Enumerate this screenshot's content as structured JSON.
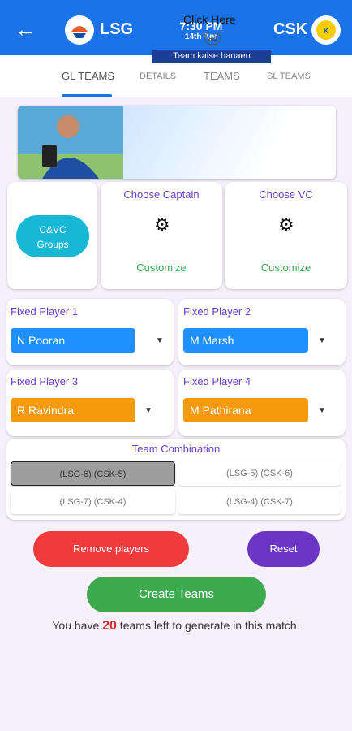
{
  "header": {
    "team_left": "LSG",
    "team_right": "CSK",
    "time": "7:30 PM",
    "date": "14th Apr"
  },
  "tabs": [
    {
      "label": "GL TEAMS"
    },
    {
      "label": "DETAILS"
    },
    {
      "label": "TEAMS"
    },
    {
      "label": "SL TEAMS"
    }
  ],
  "banner": {
    "click_here": "Click Here",
    "ad": "ad",
    "caption": "Team kaise banaen"
  },
  "cards": {
    "cvc_groups": "C&VC\nGroups",
    "captain_title": "Choose Captain",
    "captain_action": "Customize",
    "vc_title": "Choose VC",
    "vc_action": "Customize"
  },
  "fixed_players": [
    {
      "label": "Fixed Player 1",
      "value": "N Pooran"
    },
    {
      "label": "Fixed Player 2",
      "value": "M Marsh"
    },
    {
      "label": "Fixed Player 3",
      "value": "R Ravindra"
    },
    {
      "label": "Fixed Player 4",
      "value": "M Pathirana"
    }
  ],
  "combination": {
    "title": "Team Combination",
    "options": [
      "(LSG-6) (CSK-5)",
      "(LSG-5) (CSK-6)",
      "(LSG-7) (CSK-4)",
      "(LSG-4) (CSK-7)"
    ]
  },
  "actions": {
    "remove": "Remove players",
    "reset": "Reset",
    "create": "Create Teams"
  },
  "remaining": {
    "prefix": "You have ",
    "count": "20",
    "suffix": " teams left to generate in this match."
  },
  "colors": {
    "header": "#1a73e8",
    "remove": "#ef3b3b",
    "reset": "#6a35c4",
    "create": "#3eaa4e"
  }
}
